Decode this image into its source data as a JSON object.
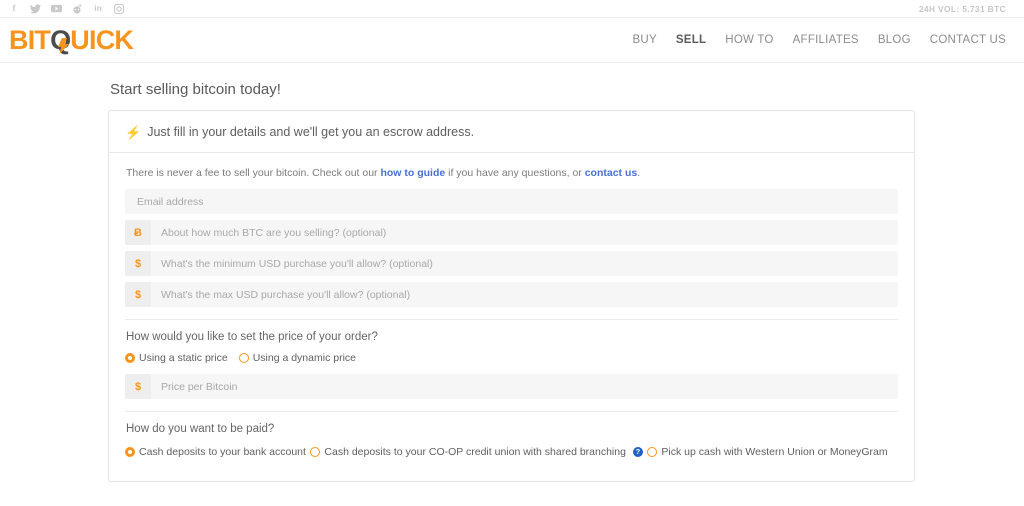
{
  "topbar": {
    "volume_text": "24H VOL: 5.731 BTC",
    "social": [
      {
        "name": "facebook-icon",
        "glyph": "f"
      },
      {
        "name": "twitter-icon",
        "glyph": "twitter"
      },
      {
        "name": "youtube-icon",
        "glyph": "youtube"
      },
      {
        "name": "reddit-icon",
        "glyph": "reddit"
      },
      {
        "name": "linkedin-icon",
        "glyph": "in"
      },
      {
        "name": "instagram-icon",
        "glyph": "instagram"
      }
    ]
  },
  "brand": {
    "part1": "BIT",
    "part2": "Q",
    "part3": "UICK",
    "orange": "#f7941e",
    "dark": "#4c4c4c"
  },
  "nav": {
    "items": [
      {
        "label": "BUY",
        "active": false
      },
      {
        "label": "SELL",
        "active": true
      },
      {
        "label": "HOW TO",
        "active": false
      },
      {
        "label": "AFFILIATES",
        "active": false
      },
      {
        "label": "BLOG",
        "active": false
      },
      {
        "label": "CONTACT US",
        "active": false
      }
    ]
  },
  "page": {
    "title": "Start selling bitcoin today!"
  },
  "panel": {
    "header": "Just fill in your details and we'll get you an escrow address.",
    "header_icon": "lightning-bolt-icon",
    "lead": {
      "text_1": "There is never a fee to sell your bitcoin. Check out our ",
      "link_1": "how to guide",
      "text_2": " if you have any questions, or ",
      "link_2": "contact us",
      "text_3": "."
    },
    "fields": [
      {
        "name": "email-field",
        "prefix": "",
        "placeholder": "Email address",
        "value": ""
      },
      {
        "name": "btc-amount-field",
        "prefix": "Ƀ",
        "placeholder": "About how much BTC are you selling? (optional)",
        "value": ""
      },
      {
        "name": "min-usd-field",
        "prefix": "$",
        "placeholder": "What's the minimum USD purchase you'll allow? (optional)",
        "value": ""
      },
      {
        "name": "max-usd-field",
        "prefix": "$",
        "placeholder": "What's the max USD purchase you'll allow? (optional)",
        "value": ""
      }
    ],
    "price_section": {
      "question": "How would you like to set the price of your order?",
      "options": [
        {
          "label": "Using a static price",
          "checked": true
        },
        {
          "label": "Using a dynamic price",
          "checked": false
        }
      ],
      "price_field": {
        "prefix": "$",
        "placeholder": "Price per Bitcoin",
        "value": ""
      }
    },
    "payment_section": {
      "question": "How do you want to be paid?",
      "options": [
        {
          "label": "Cash deposits to your bank account",
          "checked": true,
          "help": false
        },
        {
          "label": "Cash deposits to your CO-OP credit union with shared branching",
          "checked": false,
          "help": true,
          "help_glyph": "?"
        },
        {
          "label": "Pick up cash with Western Union or MoneyGram",
          "checked": false,
          "help": false
        }
      ]
    }
  }
}
